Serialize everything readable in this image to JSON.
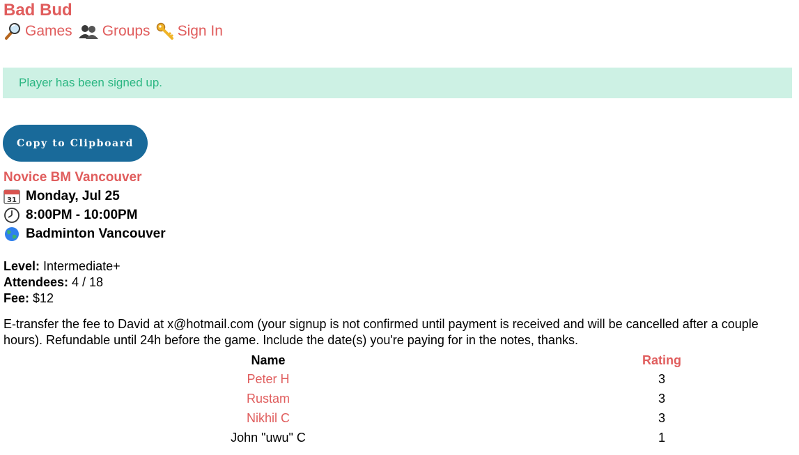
{
  "app": {
    "brand": "Bad Bud"
  },
  "nav": [
    {
      "icon": "magnifier-icon",
      "label": "Games"
    },
    {
      "icon": "group-icon",
      "label": "Groups"
    },
    {
      "icon": "key-icon",
      "label": "Sign In"
    }
  ],
  "flash": {
    "message": "Player has been signed up."
  },
  "copy_button": {
    "label": "Copy to Clipboard"
  },
  "game": {
    "title": "Novice BM Vancouver",
    "date": "Monday, Jul 25",
    "time": "8:00PM - 10:00PM",
    "location": "Badminton Vancouver",
    "level_label": "Level:",
    "level": "Intermediate+",
    "attendees_label": "Attendees:",
    "attendees": "4 / 18",
    "fee_label": "Fee:",
    "fee": "$12",
    "notice": "E-transfer the fee to David at x@hotmail.com (your signup is not confirmed until payment is received and will be cancelled after a couple hours). Refundable until 24h before the game. Include the date(s) you're paying for in the notes, thanks."
  },
  "roster": {
    "headers": {
      "name": "Name",
      "rating": "Rating"
    },
    "rows": [
      {
        "name": "Peter H",
        "rating": "3",
        "linked": true
      },
      {
        "name": "Rustam",
        "rating": "3",
        "linked": true
      },
      {
        "name": "Nikhil C",
        "rating": "3",
        "linked": true
      },
      {
        "name": "John \"uwu\" C",
        "rating": "1",
        "linked": false
      }
    ]
  },
  "colors": {
    "accent": "#e05d5d",
    "flash_bg": "#cdf1e4",
    "flash_text": "#2bb682",
    "button_bg": "#196a9a"
  }
}
